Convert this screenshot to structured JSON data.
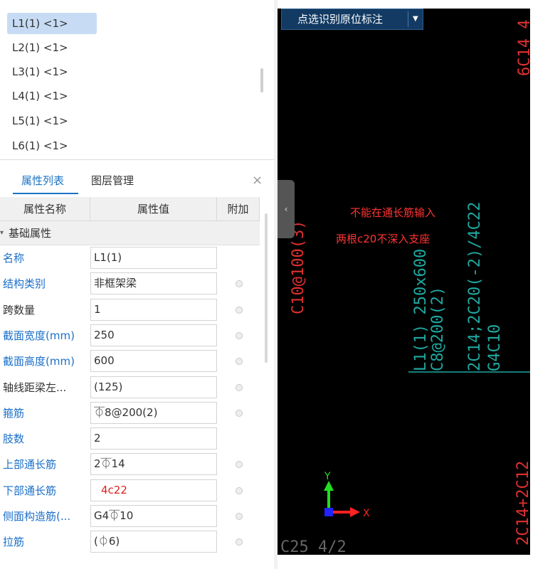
{
  "beam_list": {
    "items": [
      {
        "label": "L1(1) <1>",
        "selected": true
      },
      {
        "label": "L2(1) <1>",
        "selected": false
      },
      {
        "label": "L3(1) <1>",
        "selected": false
      },
      {
        "label": "L4(1) <1>",
        "selected": false
      },
      {
        "label": "L5(1) <1>",
        "selected": false
      },
      {
        "label": "L6(1) <1>",
        "selected": false
      }
    ]
  },
  "tabs": {
    "properties": "属性列表",
    "layers": "图层管理",
    "close": "×"
  },
  "grid": {
    "headers": {
      "name": "属性名称",
      "value": "属性值",
      "extra": "附加"
    },
    "group": "基础属性",
    "rows": [
      {
        "name": "名称",
        "value": "L1(1)",
        "name_blue": true,
        "has_dot": false,
        "value_red": false
      },
      {
        "name": "结构类别",
        "value": "非框架梁",
        "name_blue": true,
        "has_dot": true,
        "value_red": false
      },
      {
        "name": "跨数量",
        "value": "1",
        "name_blue": false,
        "has_dot": true,
        "value_red": false
      },
      {
        "name": "截面宽度(mm)",
        "value": "250",
        "name_blue": true,
        "has_dot": true,
        "value_red": false
      },
      {
        "name": "截面高度(mm)",
        "value": "600",
        "name_blue": true,
        "has_dot": true,
        "value_red": false
      },
      {
        "name": "轴线距梁左...",
        "value": "(125)",
        "name_blue": false,
        "has_dot": true,
        "value_red": false
      },
      {
        "name": "箍筋",
        "value": "⏁8@200(2)",
        "name_blue": true,
        "has_dot": true,
        "value_red": false
      },
      {
        "name": "肢数",
        "value": "2",
        "name_blue": true,
        "has_dot": false,
        "value_red": false
      },
      {
        "name": "上部通长筋",
        "value": "2⏁14",
        "name_blue": true,
        "has_dot": true,
        "value_red": false
      },
      {
        "name": "下部通长筋",
        "value": "4c22",
        "name_blue": true,
        "has_dot": true,
        "value_red": true
      },
      {
        "name": "侧面构造筋(...",
        "value": "G4⏁10",
        "name_blue": true,
        "has_dot": true,
        "value_red": false
      },
      {
        "name": "拉筋",
        "value": "(⏀6)",
        "name_blue": true,
        "has_dot": true,
        "value_red": false
      }
    ]
  },
  "cad": {
    "toolbar_label": "点选识别原位标注",
    "annotation_line1": "不能在通长筋输入",
    "annotation_line2": "两根c20不深入支座",
    "beam_text_1": "L1(1) 250x600",
    "beam_text_2": "C8@200(2)",
    "beam_text_3": "2C14;2C20(-2)/4C22",
    "beam_text_4": "G4C10",
    "left_text": "C10@100(3)",
    "top_right_text": "6C14 4",
    "bottom_left_text": "C25 4/2",
    "bottom_right_text": "2C14+2C12",
    "axis_y": "Y",
    "axis_x": "X",
    "colors": {
      "teal": "#1fa8a0",
      "red": "#e03030",
      "annotation": "#ff3333",
      "axis_green": "#22dd22",
      "axis_red": "#ff2222",
      "axis_blue": "#2222ff"
    }
  }
}
